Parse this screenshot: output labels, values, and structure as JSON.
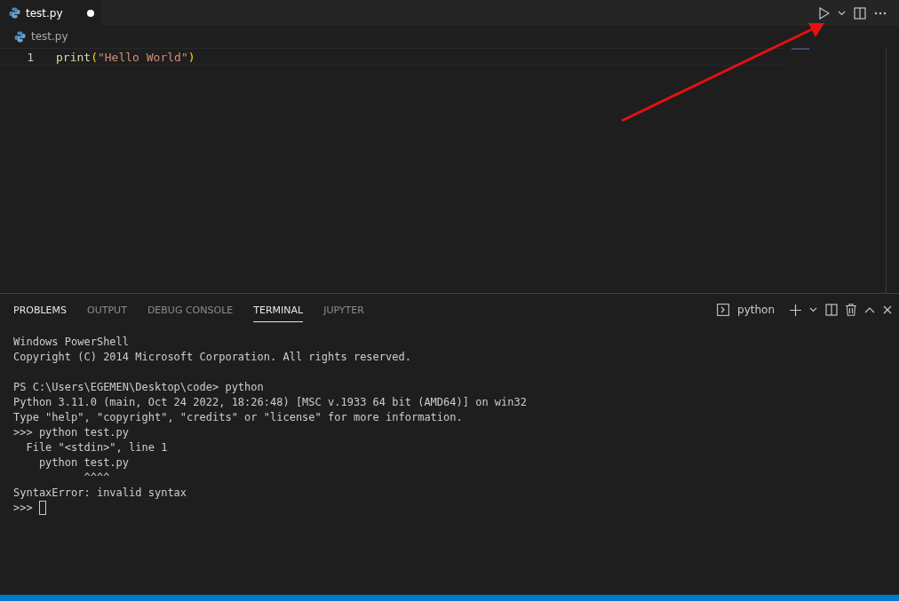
{
  "editor_tabs": [
    {
      "label": "test.py",
      "selected": true,
      "modified": true
    }
  ],
  "breadcrumb": "test.py",
  "code_lines": [
    {
      "number": "1",
      "tokens": [
        {
          "kind": "function",
          "text": "print"
        },
        {
          "kind": "bracket",
          "text": "("
        },
        {
          "kind": "string",
          "text": "\"Hello World\""
        },
        {
          "kind": "bracket",
          "text": ")"
        }
      ]
    }
  ],
  "panel_tabs": [
    {
      "label": "PROBLEMS",
      "selected": false
    },
    {
      "label": "OUTPUT",
      "selected": false
    },
    {
      "label": "DEBUG CONSOLE",
      "selected": false
    },
    {
      "label": "TERMINAL",
      "selected": true
    },
    {
      "label": "JUPYTER",
      "selected": false
    }
  ],
  "terminal_name": "python",
  "terminal_blocks": [
    [
      "Windows PowerShell",
      "Copyright (C) 2014 Microsoft Corporation. All rights reserved."
    ],
    [
      "PS C:\\Users\\EGEMEN\\Desktop\\code> python",
      "Python 3.11.0 (main, Oct 24 2022, 18:26:48) [MSC v.1933 64 bit (AMD64)] on win32",
      "Type \"help\", \"copyright\", \"credits\" or \"license\" for more information.",
      ">>> python test.py",
      "  File \"<stdin>\", line 1",
      "    python test.py",
      "           ^^^^",
      "SyntaxError: invalid syntax",
      ">>> "
    ]
  ],
  "cursor": true
}
